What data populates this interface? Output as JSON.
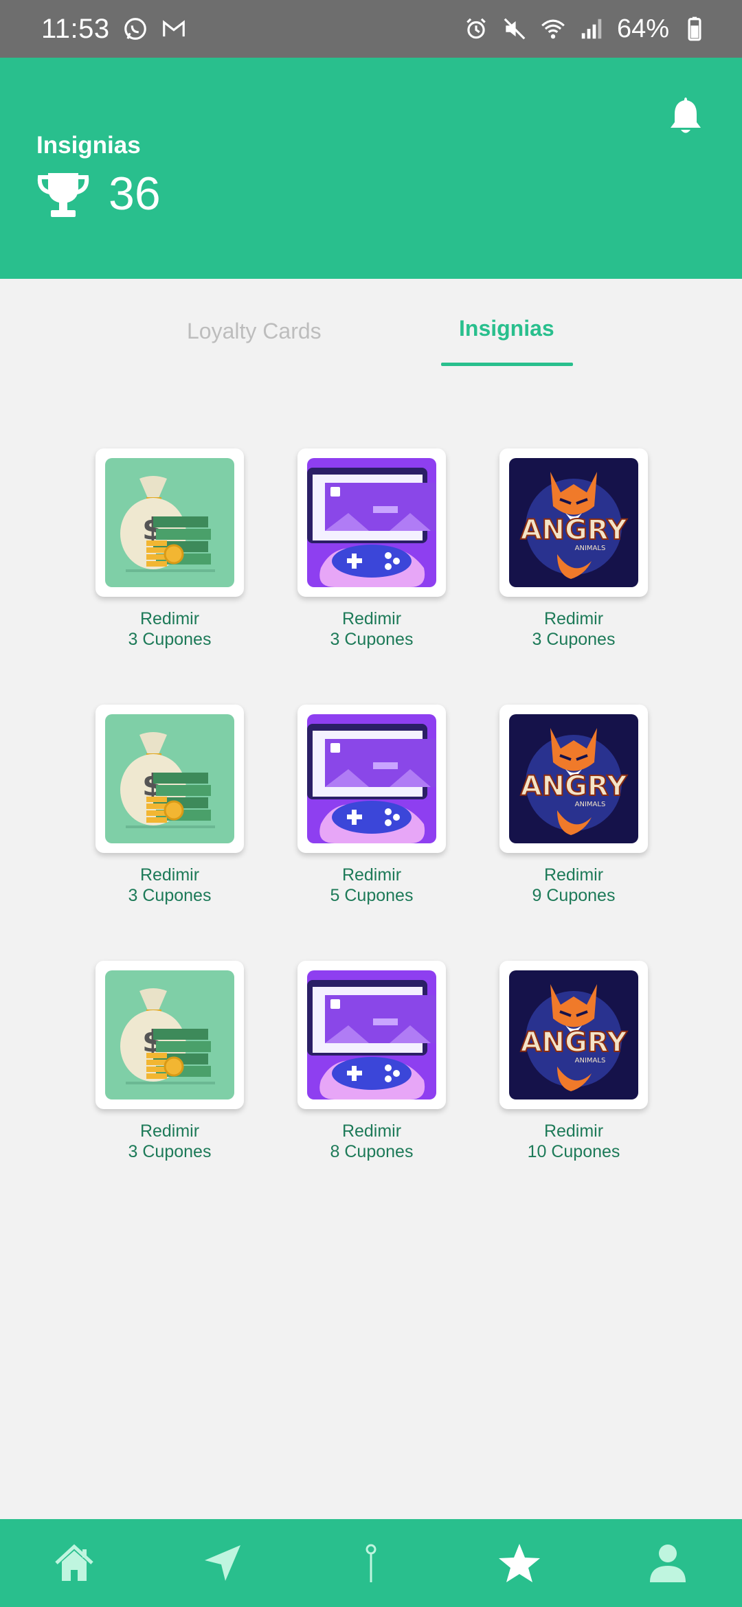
{
  "status_bar": {
    "time": "11:53",
    "battery": "64%",
    "left_icons": [
      "whatsapp-icon",
      "gmail-icon"
    ],
    "right_icons": [
      "alarm-icon",
      "mute-icon",
      "wifi-icon",
      "signal-icon",
      "battery-icon"
    ]
  },
  "header": {
    "label": "Insignias",
    "count": "36",
    "icons": [
      "trophy-icon",
      "bell-icon"
    ]
  },
  "tabs": [
    {
      "label": "Loyalty Cards",
      "active": false
    },
    {
      "label": "Insignias",
      "active": true
    }
  ],
  "badges": [
    {
      "image": "money-bag",
      "line1": "Redimir",
      "line2": "3 Cupones"
    },
    {
      "image": "gamepad",
      "line1": "Redimir",
      "line2": "3 Cupones"
    },
    {
      "image": "angry-animals",
      "line1": "Redimir",
      "line2": "3 Cupones"
    },
    {
      "image": "money-bag",
      "line1": "Redimir",
      "line2": "3 Cupones"
    },
    {
      "image": "gamepad",
      "line1": "Redimir",
      "line2": "5 Cupones"
    },
    {
      "image": "angry-animals",
      "line1": "Redimir",
      "line2": "9 Cupones"
    },
    {
      "image": "money-bag",
      "line1": "Redimir",
      "line2": "3 Cupones"
    },
    {
      "image": "gamepad",
      "line1": "Redimir",
      "line2": "8 Cupones"
    },
    {
      "image": "angry-animals",
      "line1": "Redimir",
      "line2": "10 Cupones"
    }
  ],
  "angry_logo": {
    "word": "ANGRY",
    "sub": "ANIMALS"
  },
  "bottom_nav": [
    "home-icon",
    "navigate-icon",
    "pin-icon",
    "star-icon",
    "profile-icon"
  ],
  "colors": {
    "primary": "#29bf8d",
    "status_bar": "#6e6e6e",
    "background": "#f2f2f2",
    "badge_text": "#1d7a58",
    "inactive_tab": "#bdbdbd"
  }
}
